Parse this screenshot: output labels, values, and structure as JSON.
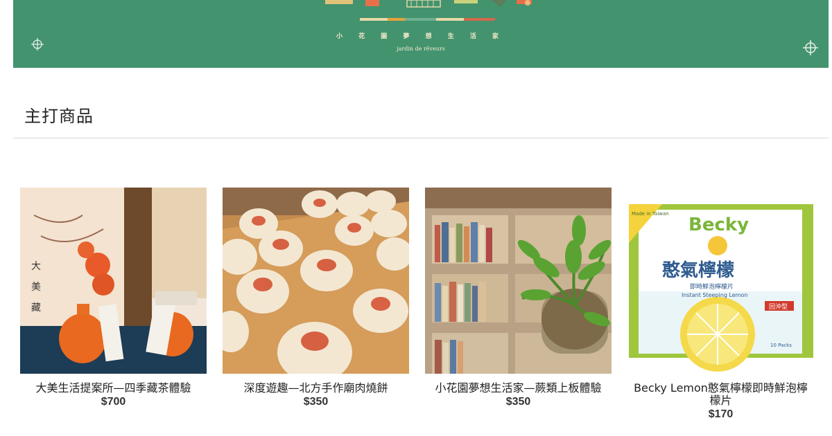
{
  "banner": {
    "title": "小 花 園 夢 想 生 活 家",
    "subtitle": "jardin de rêveurs",
    "background": "#43936f",
    "icons": [
      "crosshair-icon",
      "crosshair-icon"
    ]
  },
  "section": {
    "title": "主打商品"
  },
  "products": [
    {
      "name": "大美生活提案所—四季藏茶體驗",
      "price": "$700"
    },
    {
      "name": "深度遊趣—北方手作廟肉燒餅",
      "price": "$350"
    },
    {
      "name": "小花園夢想生活家—蕨類上板體驗",
      "price": "$350"
    },
    {
      "name": "Becky Lemon憨氣檸檬即時鮮泡檸檬片",
      "price": "$170",
      "package": {
        "brand": "Becky",
        "title": "憨氣檸檬",
        "subtitle": "即時鮮泡檸檬片",
        "english": "Instant Steeping Lemon",
        "badge_top": "Made in Taiwan",
        "badge_side": "回沖型",
        "count": "10 Packs"
      }
    }
  ]
}
